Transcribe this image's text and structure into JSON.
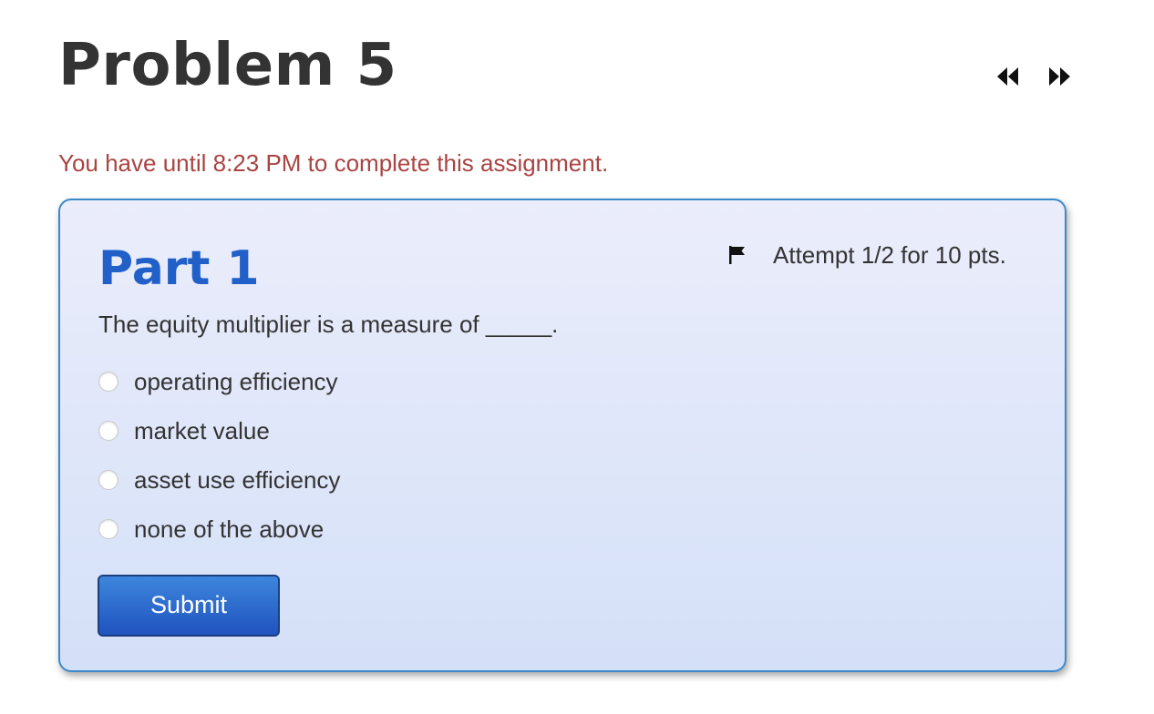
{
  "problem": {
    "title": "Problem 5",
    "deadline": "You have until 8:23 PM to complete this assignment."
  },
  "nav": {
    "previous_icon": "double-chevron-left-icon",
    "next_icon": "double-chevron-right-icon"
  },
  "part": {
    "title": "Part 1",
    "flag_icon": "flag-icon",
    "attempt": "Attempt 1/2 for 10 pts.",
    "question": "The equity multiplier is a measure of _____.",
    "options": [
      {
        "label": "operating efficiency",
        "selected": false
      },
      {
        "label": "market value",
        "selected": false
      },
      {
        "label": "asset use efficiency",
        "selected": false
      },
      {
        "label": "none of the above",
        "selected": false
      }
    ],
    "submit_label": "Submit"
  },
  "colors": {
    "deadline": "#a94442",
    "part_title": "#2060c8",
    "panel_border": "#3c89c9",
    "submit": "#2a66cc"
  }
}
